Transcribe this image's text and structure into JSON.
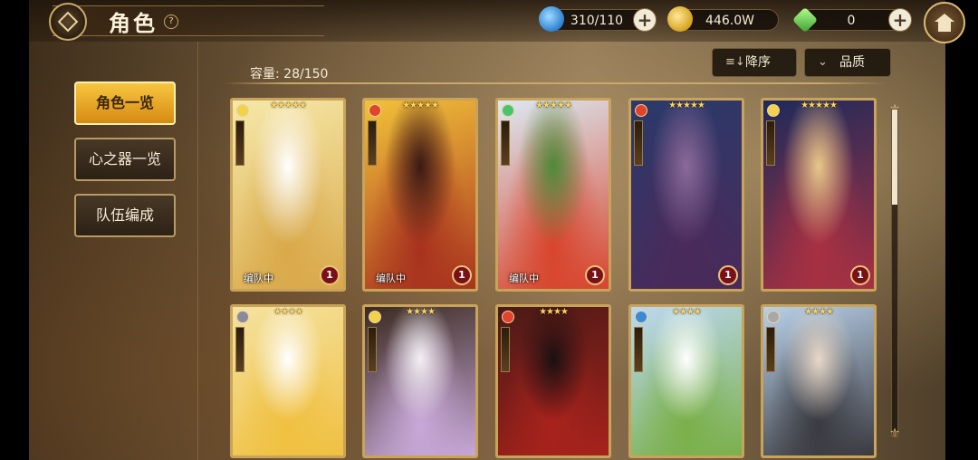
{
  "header": {
    "title": "角色",
    "help_glyph": "?"
  },
  "resources": [
    {
      "name": "stamina",
      "icon": "water-drop-icon",
      "value": "310/110"
    },
    {
      "name": "gold",
      "icon": "gold-coin-icon",
      "value": "446.0W"
    },
    {
      "name": "gem",
      "icon": "green-crystal-icon",
      "value": "0"
    }
  ],
  "plus_glyph": "+",
  "sidebar": {
    "items": [
      {
        "label": "角色一览",
        "active": true
      },
      {
        "label": "心之器一览",
        "active": false
      },
      {
        "label": "队伍编成",
        "active": false
      }
    ]
  },
  "capacity": "容量: 28/150",
  "sort": {
    "order_label": "降序",
    "order_glyph": "≡↓",
    "filter_label": "品质",
    "filter_glyph": "⌄"
  },
  "cards": [
    {
      "stars": "★★★★★",
      "element": "light",
      "element_color": "#f2d24a",
      "in_team": "编队中",
      "level": "1",
      "colors": [
        "#f6e8a8",
        "#d9a94a",
        "#ffffff"
      ]
    },
    {
      "stars": "★★★★★",
      "element": "fire",
      "element_color": "#e2432a",
      "in_team": "编队中",
      "level": "1",
      "colors": [
        "#f2c23a",
        "#a8321e",
        "#3a1a14"
      ]
    },
    {
      "stars": "★★★★★",
      "element": "wind",
      "element_color": "#4ac46a",
      "in_team": "编队中",
      "level": "1",
      "colors": [
        "#dbe9f2",
        "#d8442c",
        "#4e8a3a"
      ]
    },
    {
      "stars": "★★★★★",
      "element": "fire",
      "element_color": "#e2432a",
      "in_team": "",
      "level": "1",
      "colors": [
        "#2a3a6a",
        "#4a2a5a",
        "#8a6a9a"
      ]
    },
    {
      "stars": "★★★★★",
      "element": "light",
      "element_color": "#f2d24a",
      "in_team": "",
      "level": "1",
      "colors": [
        "#1e2a5a",
        "#a83042",
        "#e8c88a"
      ]
    },
    {
      "stars": "★★★★",
      "element": "dark",
      "element_color": "#8a8a9a",
      "in_team": "",
      "level": "",
      "colors": [
        "#f4e2a0",
        "#f0c040",
        "#ffffff"
      ]
    },
    {
      "stars": "★★★★",
      "element": "light",
      "element_color": "#f2d24a",
      "in_team": "",
      "level": "",
      "colors": [
        "#3a2a20",
        "#c8a8d8",
        "#f4f0f4"
      ]
    },
    {
      "stars": "★★★★",
      "element": "fire",
      "element_color": "#e2432a",
      "in_team": "",
      "level": "",
      "colors": [
        "#4a1a16",
        "#a8221c",
        "#1a1012"
      ]
    },
    {
      "stars": "★★★★",
      "element": "water",
      "element_color": "#3a8ad8",
      "in_team": "",
      "level": "",
      "colors": [
        "#bcd8f0",
        "#7ab04a",
        "#ffffff"
      ]
    },
    {
      "stars": "★★★★",
      "element": "earth",
      "element_color": "#a8a8a8",
      "in_team": "",
      "level": "",
      "colors": [
        "#b8d0e8",
        "#3a3a40",
        "#e8d8c8"
      ]
    }
  ]
}
